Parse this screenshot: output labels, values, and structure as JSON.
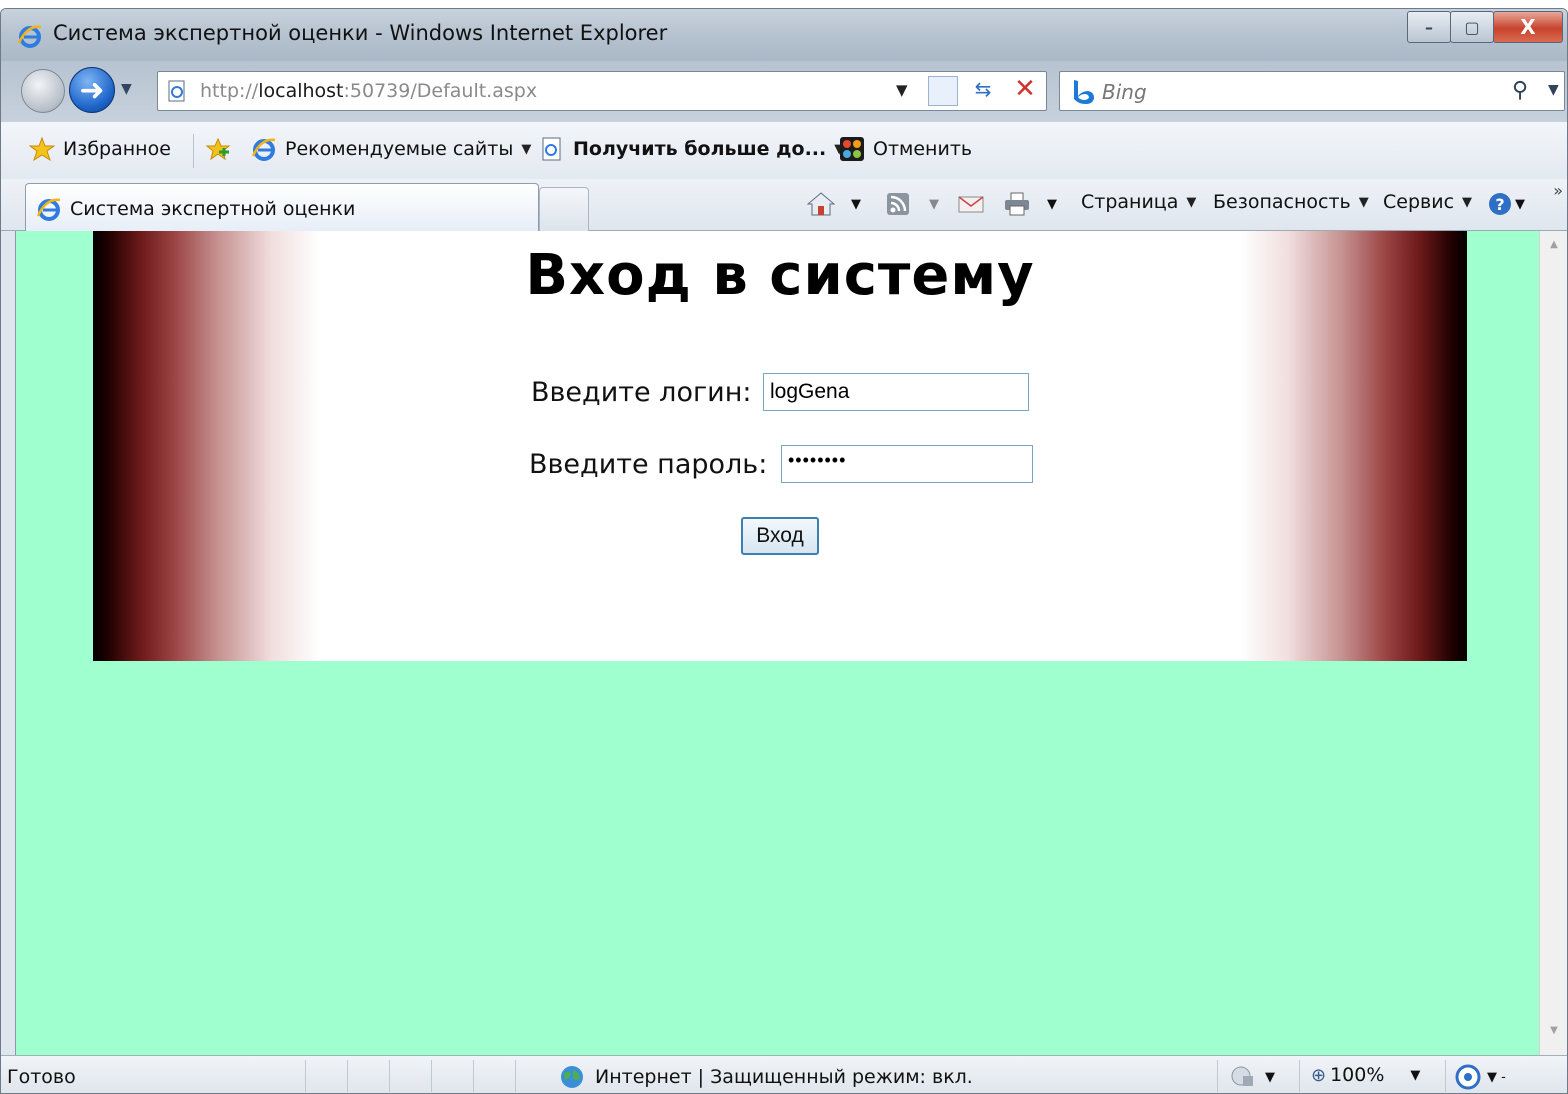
{
  "window": {
    "title": "Система экспертной оценки - Windows Internet Explorer",
    "minimize_glyph": "–",
    "maximize_glyph": "▢",
    "close_glyph": "X"
  },
  "address_bar": {
    "url_prefix": "http://",
    "url_host": "localhost",
    "url_rest": ":50739/Default.aspx"
  },
  "search": {
    "placeholder": "Bing"
  },
  "favorites_bar": {
    "favorites_label": "Избранное",
    "suggested_sites": "Рекомендуемые сайты",
    "get_more": "Получить больше до...",
    "undo": "Отменить"
  },
  "tabs": {
    "active_label": "Система экспертной оценки"
  },
  "command_bar": {
    "page": "Страница",
    "safety": "Безопасность",
    "tools": "Сервис",
    "more": "»"
  },
  "page": {
    "title": "Вход в систему",
    "login_label": "Введите логин:",
    "login_value": "logGena",
    "password_label": "Введите пароль:",
    "password_value": "••••••••",
    "submit_label": "Вход"
  },
  "status_bar": {
    "status": "Готово",
    "zone": "Интернет | Защищенный режим: вкл.",
    "zoom": "100%"
  },
  "colors": {
    "page_background": "#a0ffcf",
    "banner_edge": "#000000",
    "banner_mid": "#9c4646"
  }
}
